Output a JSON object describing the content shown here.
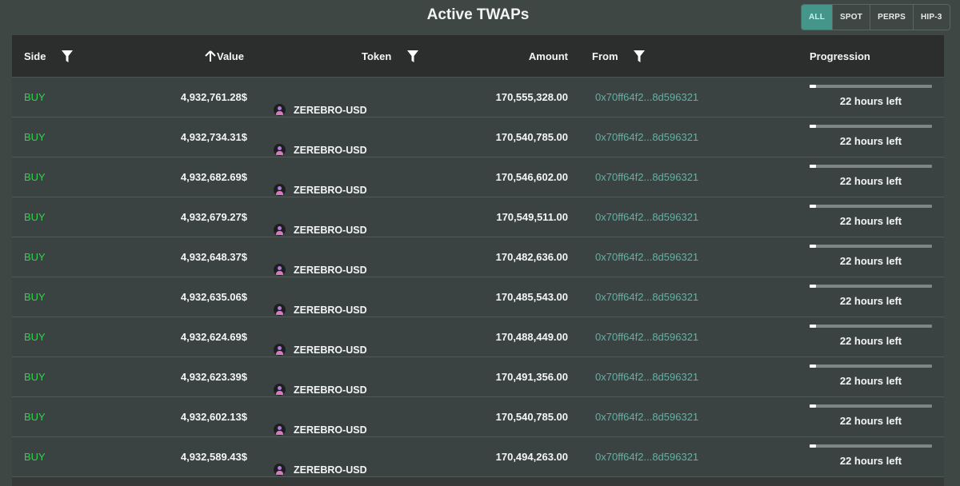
{
  "header": {
    "title": "Active TWAPs",
    "filters": [
      {
        "label": "ALL",
        "active": true
      },
      {
        "label": "SPOT",
        "active": false
      },
      {
        "label": "PERPS",
        "active": false
      },
      {
        "label": "HIP-3",
        "active": false
      }
    ]
  },
  "table": {
    "columns": {
      "side": "Side",
      "value": "Value",
      "token": "Token",
      "amount": "Amount",
      "from": "From",
      "progression": "Progression"
    },
    "rows": [
      {
        "side": "BUY",
        "value": "4,932,761.28$",
        "token": "ZEREBRO-USD",
        "amount": "170,555,328.00",
        "from": "0x70ff64f2...8d596321",
        "progress": 0.05,
        "time_left": "22 hours left"
      },
      {
        "side": "BUY",
        "value": "4,932,734.31$",
        "token": "ZEREBRO-USD",
        "amount": "170,540,785.00",
        "from": "0x70ff64f2...8d596321",
        "progress": 0.05,
        "time_left": "22 hours left"
      },
      {
        "side": "BUY",
        "value": "4,932,682.69$",
        "token": "ZEREBRO-USD",
        "amount": "170,546,602.00",
        "from": "0x70ff64f2...8d596321",
        "progress": 0.05,
        "time_left": "22 hours left"
      },
      {
        "side": "BUY",
        "value": "4,932,679.27$",
        "token": "ZEREBRO-USD",
        "amount": "170,549,511.00",
        "from": "0x70ff64f2...8d596321",
        "progress": 0.05,
        "time_left": "22 hours left"
      },
      {
        "side": "BUY",
        "value": "4,932,648.37$",
        "token": "ZEREBRO-USD",
        "amount": "170,482,636.00",
        "from": "0x70ff64f2...8d596321",
        "progress": 0.05,
        "time_left": "22 hours left"
      },
      {
        "side": "BUY",
        "value": "4,932,635.06$",
        "token": "ZEREBRO-USD",
        "amount": "170,485,543.00",
        "from": "0x70ff64f2...8d596321",
        "progress": 0.05,
        "time_left": "22 hours left"
      },
      {
        "side": "BUY",
        "value": "4,932,624.69$",
        "token": "ZEREBRO-USD",
        "amount": "170,488,449.00",
        "from": "0x70ff64f2...8d596321",
        "progress": 0.05,
        "time_left": "22 hours left"
      },
      {
        "side": "BUY",
        "value": "4,932,623.39$",
        "token": "ZEREBRO-USD",
        "amount": "170,491,356.00",
        "from": "0x70ff64f2...8d596321",
        "progress": 0.05,
        "time_left": "22 hours left"
      },
      {
        "side": "BUY",
        "value": "4,932,602.13$",
        "token": "ZEREBRO-USD",
        "amount": "170,540,785.00",
        "from": "0x70ff64f2...8d596321",
        "progress": 0.05,
        "time_left": "22 hours left"
      },
      {
        "side": "BUY",
        "value": "4,932,589.43$",
        "token": "ZEREBRO-USD",
        "amount": "170,494,263.00",
        "from": "0x70ff64f2...8d596321",
        "progress": 0.05,
        "time_left": "22 hours left"
      }
    ]
  },
  "colors": {
    "background": "#3e4744",
    "buy": "#2bd54a",
    "address": "#5fb3a6",
    "active_filter": "#46958a"
  }
}
